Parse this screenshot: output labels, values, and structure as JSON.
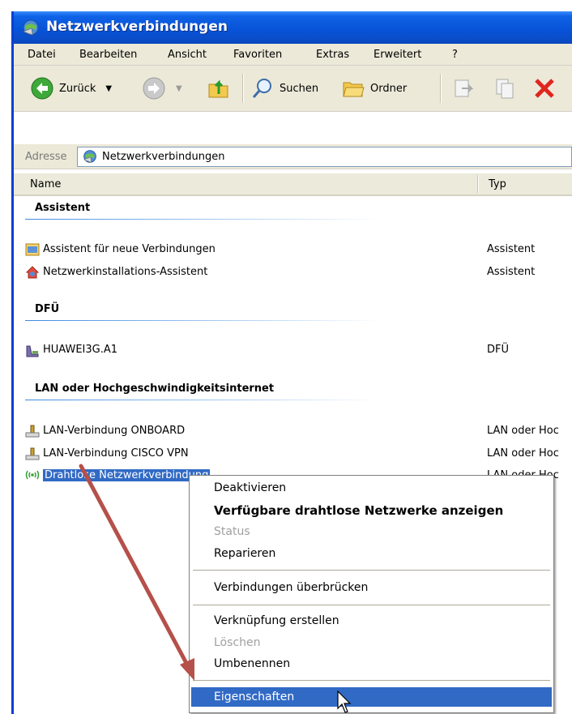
{
  "window": {
    "title": "Netzwerkverbindungen"
  },
  "menu": [
    "Datei",
    "Bearbeiten",
    "Ansicht",
    "Favoriten",
    "Extras",
    "Erweitert",
    "?"
  ],
  "toolbar": {
    "back_label": "Zurück",
    "search_label": "Suchen",
    "folders_label": "Ordner"
  },
  "address": {
    "label": "Adresse",
    "value": "Netzwerkverbindungen"
  },
  "columns": {
    "name": "Name",
    "type": "Typ"
  },
  "groups": [
    {
      "title": "Assistent",
      "items": [
        {
          "name": "Assistent für neue Verbindungen",
          "type": "Assistent",
          "icon": "wizard-icon"
        },
        {
          "name": "Netzwerkinstallations-Assistent",
          "type": "Assistent",
          "icon": "home-network-icon"
        }
      ]
    },
    {
      "title": "DFÜ",
      "items": [
        {
          "name": "HUAWEI3G.A1",
          "type": "DFÜ",
          "icon": "modem-icon"
        }
      ]
    },
    {
      "title": "LAN oder Hochgeschwindigkeitsinternet",
      "items": [
        {
          "name": "LAN-Verbindung ONBOARD",
          "type": "LAN oder Hoc",
          "icon": "lan-icon"
        },
        {
          "name": "LAN-Verbindung CISCO VPN",
          "type": "LAN oder Hoc",
          "icon": "lan-icon"
        },
        {
          "name": "Drahtlose Netzwerkverbindung",
          "type": "LAN oder Hoc",
          "icon": "wireless-icon",
          "selected": true
        }
      ]
    }
  ],
  "context_menu": {
    "items": [
      {
        "label": "Deaktivieren"
      },
      {
        "label": "Verfügbare drahtlose Netzwerke anzeigen",
        "bold": true
      },
      {
        "label": "Status",
        "disabled": true
      },
      {
        "label": "Reparieren"
      },
      {
        "label": "Verbindungen überbrücken"
      },
      {
        "label": "Verknüpfung erstellen"
      },
      {
        "label": "Löschen",
        "disabled": true
      },
      {
        "label": "Umbenennen"
      },
      {
        "label": "Eigenschaften",
        "highlighted": true
      }
    ]
  },
  "colors": {
    "titlebar": "#0752d6",
    "selection": "#316ac5",
    "annotation_arrow": "#b5504a"
  }
}
